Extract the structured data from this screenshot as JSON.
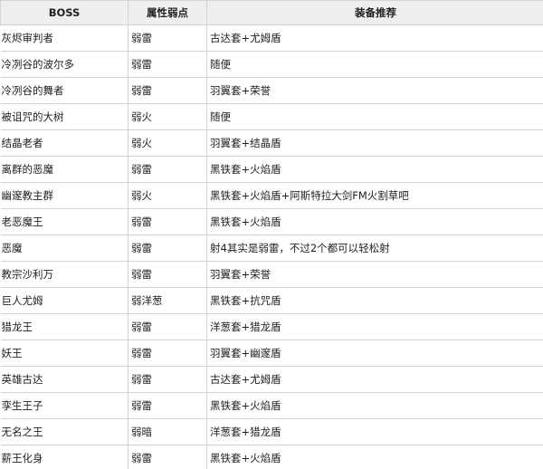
{
  "table": {
    "headers": [
      "BOSS",
      "属性弱点",
      "装备推荐"
    ],
    "rows": [
      [
        "灰烬审判者",
        "弱雷",
        "古达套+尤姆盾"
      ],
      [
        "冷冽谷的波尔多",
        "弱雷",
        "随便"
      ],
      [
        "冷冽谷的舞者",
        "弱雷",
        "羽翼套+荣誉"
      ],
      [
        "被诅咒的大树",
        "弱火",
        "随便"
      ],
      [
        "结晶老者",
        "弱火",
        "羽翼套+结晶盾"
      ],
      [
        "离群的恶魔",
        "弱雷",
        "黑铁套+火焰盾"
      ],
      [
        "幽邃教主群",
        "弱火",
        "黑铁套+火焰盾+阿斯特拉大剑FM火割草吧"
      ],
      [
        "老恶魔王",
        "弱雷",
        "黑铁套+火焰盾"
      ],
      [
        "恶魔",
        "弱雷",
        "射4其实是弱雷，不过2个都可以轻松射"
      ],
      [
        "教宗沙利万",
        "弱雷",
        "羽翼套+荣誉"
      ],
      [
        "巨人尤姆",
        "弱洋葱",
        "黑铁套+抗咒盾"
      ],
      [
        "猎龙王",
        "弱雷",
        "洋葱套+猎龙盾"
      ],
      [
        "妖王",
        "弱雷",
        "羽翼套+幽邃盾"
      ],
      [
        "英雄古达",
        "弱雷",
        "古达套+尤姆盾"
      ],
      [
        "孪生王子",
        "弱雷",
        "黑铁套+火焰盾"
      ],
      [
        "无名之王",
        "弱暗",
        "洋葱套+猎龙盾"
      ],
      [
        "薪王化身",
        "弱雷",
        "黑铁套+火焰盾"
      ]
    ]
  }
}
